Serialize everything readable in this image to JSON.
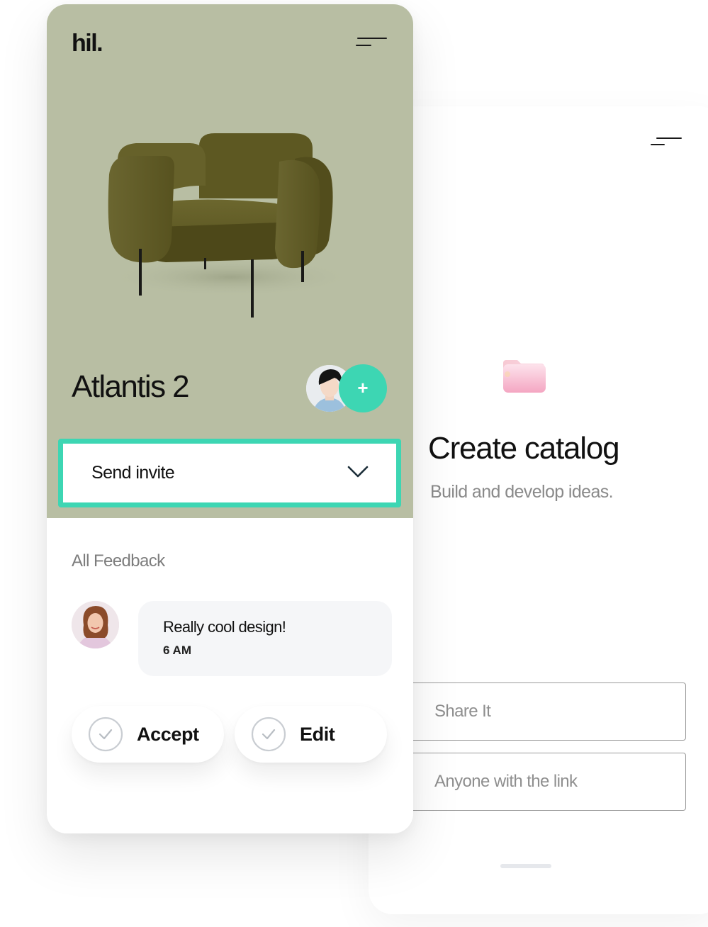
{
  "brand": {
    "logo_text": "hil."
  },
  "product": {
    "title": "Atlantis 2",
    "add_collaborator_label": "+"
  },
  "invite": {
    "selected_value": "Send invite"
  },
  "feedback": {
    "heading": "All Feedback",
    "comments": [
      {
        "text": "Really cool design!",
        "time": "6 AM"
      }
    ]
  },
  "actions": {
    "accept_label": "Accept",
    "edit_label": "Edit"
  },
  "catalog": {
    "title": "Create catalog",
    "subtitle": "Build and develop ideas.",
    "share_field_placeholder": "Share It",
    "access_field_value": "Anyone with the link"
  },
  "colors": {
    "hero_background": "#b8bea3",
    "accent": "#3dd6b3",
    "chair": "#5f5a26",
    "text_primary": "#111111",
    "text_muted": "#8a8a8a"
  },
  "icons": {
    "menu": "hamburger-menu-icon",
    "chevron": "chevron-down-icon",
    "check": "check-circle-icon",
    "folder": "folder-icon",
    "plus": "plus-icon"
  }
}
